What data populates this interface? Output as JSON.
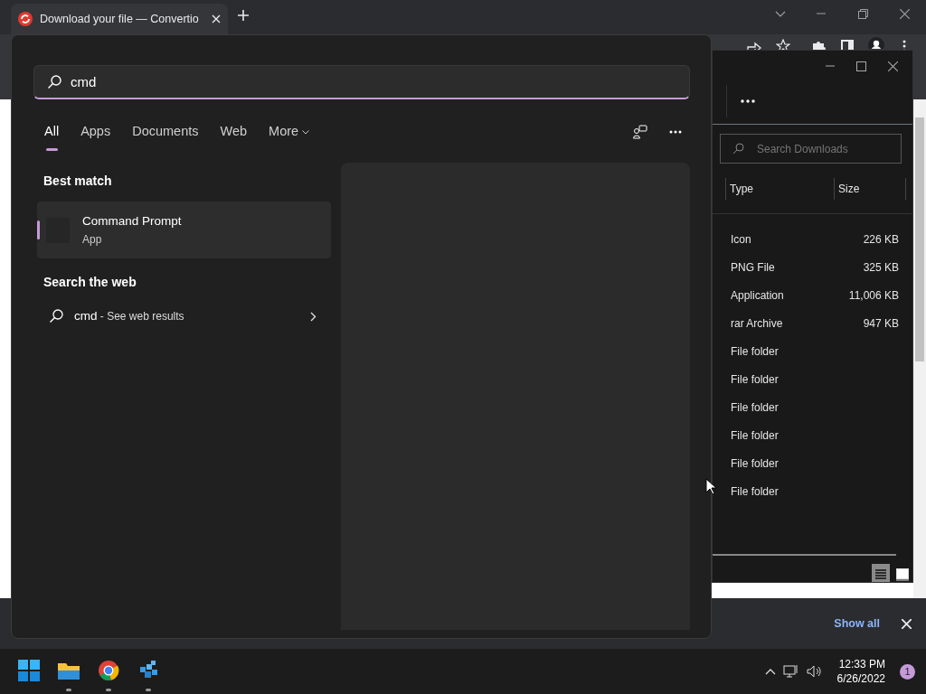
{
  "browser": {
    "tab_title": "Download your file — Convertio"
  },
  "explorer": {
    "search": {
      "placeholder": "Search Downloads"
    },
    "columns": [
      "Type",
      "Size"
    ],
    "rows": [
      {
        "type": "Icon",
        "size": "226 KB"
      },
      {
        "type": "PNG File",
        "size": "325 KB"
      },
      {
        "type": "Application",
        "size": "11,006 KB"
      },
      {
        "type": "rar Archive",
        "size": "947 KB"
      },
      {
        "type": "File folder"
      },
      {
        "type": "File folder"
      },
      {
        "type": "File folder"
      },
      {
        "type": "File folder"
      },
      {
        "type": "File folder"
      },
      {
        "type": "File folder"
      }
    ],
    "views": [
      {
        "kind": "details",
        "selected": true
      },
      {
        "kind": "preview",
        "selected": false
      }
    ]
  },
  "download_bar": {
    "show_all": "Show all"
  },
  "search": {
    "query": "cmd",
    "filters": [
      {
        "label": "All",
        "selected": true
      },
      {
        "label": "Apps",
        "selected": false
      },
      {
        "label": "Documents",
        "selected": false
      },
      {
        "label": "Web",
        "selected": false
      },
      {
        "label": "More",
        "selected": false,
        "dropdown": true
      }
    ],
    "best_match": {
      "heading": "Best match",
      "title": "Command Prompt",
      "subtitle": "App",
      "selected": true
    },
    "web": {
      "heading": "Search the web",
      "query": "cmd",
      "suffix": "- See web results"
    }
  },
  "taskbar": {
    "apps": [
      {
        "kind": "folder",
        "running": true
      },
      {
        "kind": "browser",
        "running": true
      },
      {
        "kind": "cubes",
        "running": true
      }
    ],
    "time": "12:33 PM",
    "date": "6/26/2022",
    "badge": "1"
  }
}
